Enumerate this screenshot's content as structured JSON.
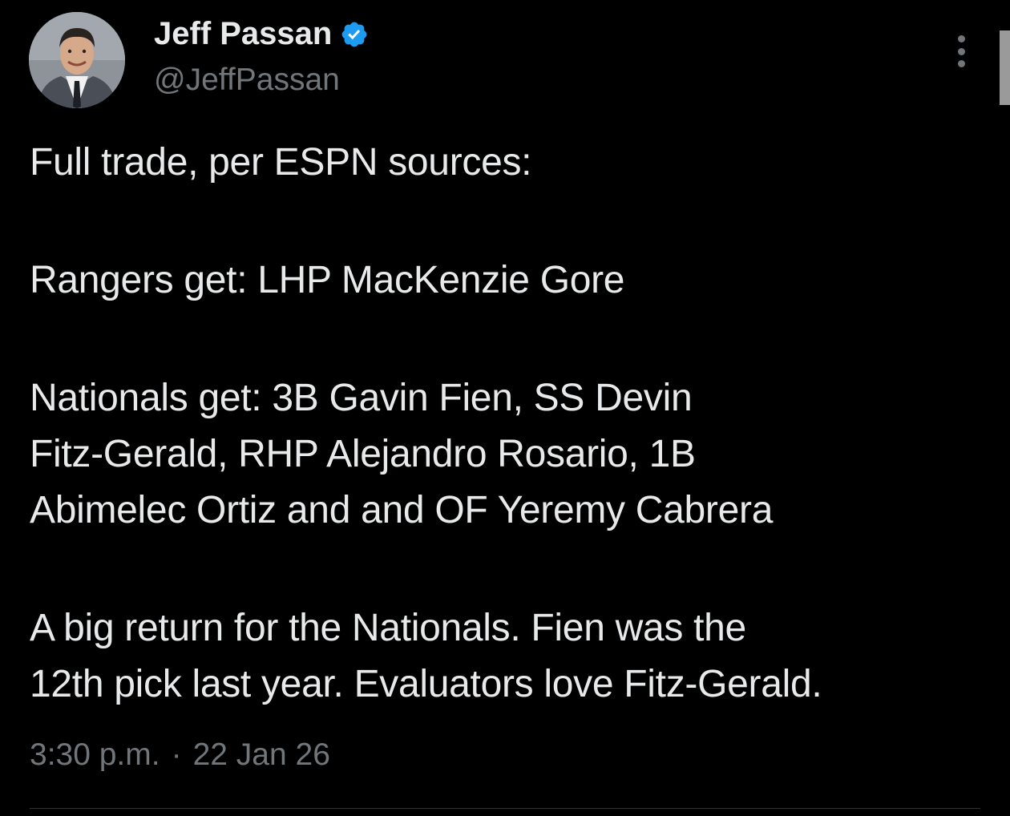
{
  "author": {
    "display_name": "Jeff Passan",
    "handle": "@JeffPassan",
    "verified": true,
    "verified_color": "#1d9bf0"
  },
  "tweet": {
    "paragraphs": [
      [
        "Full trade, per ESPN sources:"
      ],
      [
        "Rangers get: LHP MacKenzie Gore"
      ],
      [
        "Nationals get: 3B Gavin Fien, SS Devin",
        "Fitz-Gerald, RHP Alejandro Rosario, 1B",
        "Abimelec Ortiz and and OF Yeremy Cabrera"
      ],
      [
        "A big return for the Nationals. Fien was the",
        "12th pick last year. Evaluators love Fitz-Gerald."
      ]
    ]
  },
  "meta": {
    "time": "3:30 p.m.",
    "separator": "·",
    "date": "22 Jan 26"
  },
  "icons": {
    "more": "more-options-icon",
    "verified": "verified-badge-icon"
  },
  "colors": {
    "background": "#000000",
    "text": "#e7e9ea",
    "secondary": "#71767b"
  }
}
